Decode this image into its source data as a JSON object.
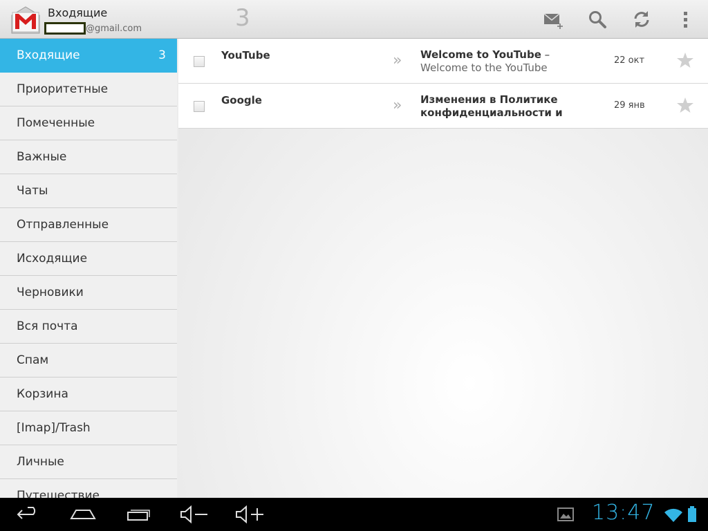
{
  "actionbar": {
    "title": "Входящие",
    "account_suffix": "@gmail.com",
    "unread_count": "3",
    "icons": [
      "gmail-logo-icon",
      "compose-icon",
      "search-icon",
      "refresh-icon",
      "overflow-menu-icon"
    ]
  },
  "sidebar": {
    "folders": [
      {
        "label": "Входящие",
        "count": "3"
      },
      {
        "label": "Приоритетные",
        "count": ""
      },
      {
        "label": "Помеченные",
        "count": ""
      },
      {
        "label": "Важные",
        "count": ""
      },
      {
        "label": "Чаты",
        "count": ""
      },
      {
        "label": "Отправленные",
        "count": ""
      },
      {
        "label": "Исходящие",
        "count": ""
      },
      {
        "label": "Черновики",
        "count": ""
      },
      {
        "label": "Вся почта",
        "count": ""
      },
      {
        "label": "Спам",
        "count": ""
      },
      {
        "label": "Корзина",
        "count": ""
      },
      {
        "label": "[Imap]/Trash",
        "count": ""
      },
      {
        "label": "Личные",
        "count": ""
      },
      {
        "label": "Путешествие",
        "count": ""
      }
    ]
  },
  "messages": [
    {
      "sender": "YouTube",
      "subject": "Welcome to YouTube",
      "separator": " – ",
      "snippet": "Welcome to the YouTube",
      "date": "22 окт"
    },
    {
      "sender": "Google",
      "subject": "Изменения в Политике конфиденциальности и",
      "separator": "",
      "snippet": "",
      "date": "29 янв"
    }
  ],
  "systembar": {
    "clock": "13:47",
    "icons": [
      "back-icon",
      "home-icon",
      "recent-apps-icon",
      "volume-down-icon",
      "volume-up-icon",
      "gallery-notification-icon",
      "wifi-icon",
      "battery-icon"
    ]
  },
  "colors": {
    "accent": "#33b5e5",
    "actionbar_bg": "#e6e6e6",
    "sysbar_bg": "#000000"
  }
}
